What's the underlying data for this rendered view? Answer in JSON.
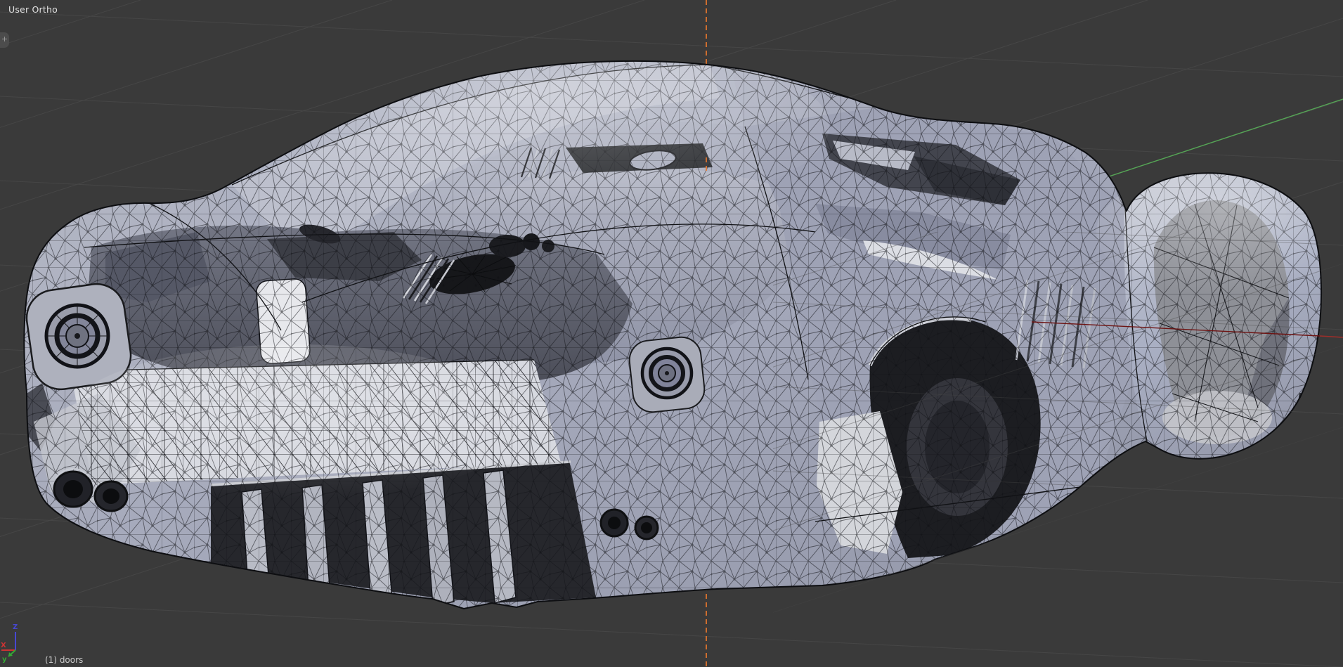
{
  "viewport": {
    "view_label": "User Ortho",
    "selection_label": "(1) doors",
    "toolshelf_tab": "+",
    "gizmo": {
      "x": "X",
      "y": "y",
      "z": "Z"
    },
    "colors": {
      "background": "#3a3a3a",
      "grid": "#464646",
      "axis_y_green": "#55a555",
      "axis_x_red_bright": "#9c2e2a",
      "axis_x_red_dim": "#6e1413",
      "cursor_line_orange": "#e8772d",
      "hud_text": "#e2e2e2",
      "status_text": "#cccccc",
      "gizmo_x": "#cc3333",
      "gizmo_y": "#33aa33",
      "gizmo_z": "#4747d1"
    }
  }
}
